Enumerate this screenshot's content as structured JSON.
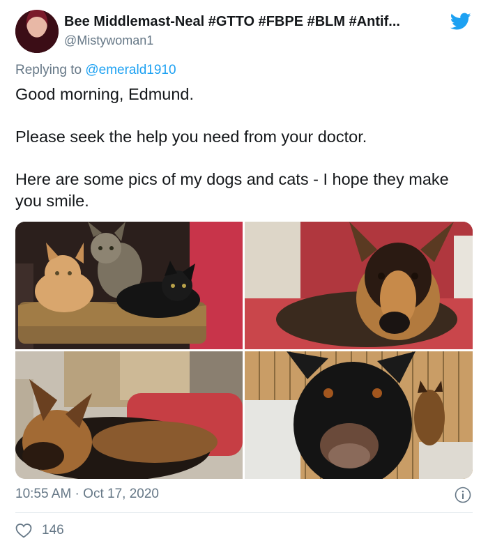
{
  "tweet": {
    "display_name": "Bee Middlemast-Neal #GTTO #FBPE #BLM #Antif...",
    "handle": "@Mistywoman1",
    "replying_prefix": "Replying to ",
    "replying_to": "@emerald1910",
    "text_lines": [
      "Good morning, Edmund.",
      "Please seek the help you need from your doctor.",
      "Here are some pics of my dogs and cats - I hope they make you smile."
    ],
    "time": "10:55 AM · Oct 17, 2020",
    "likes": "146"
  },
  "icons": {
    "brand": "twitter-bird-icon",
    "info": "info-icon",
    "like": "heart-icon"
  },
  "colors": {
    "brand_blue": "#1da1f2",
    "secondary_text": "#657786",
    "primary_text": "#14171a"
  }
}
